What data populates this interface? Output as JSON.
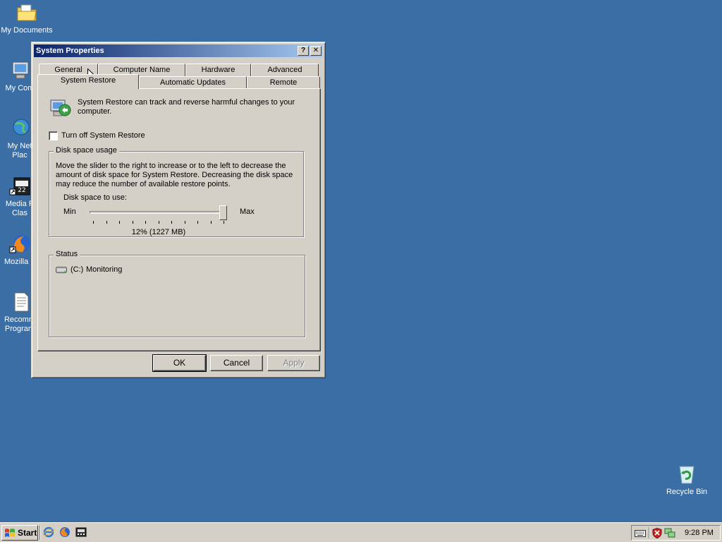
{
  "desktop": {
    "icons": [
      {
        "label": "My Documents",
        "icon": "folder-documents-icon"
      },
      {
        "label": "My Com",
        "icon": "computer-icon"
      },
      {
        "label": "My Net",
        "label2": "Plac",
        "icon": "network-places-icon"
      },
      {
        "label": "Media P",
        "label2": "Clas",
        "icon": "media-player-shortcut-icon"
      },
      {
        "label": "Mozilla F",
        "icon": "firefox-shortcut-icon"
      },
      {
        "label": "Recomm",
        "label2": "Program",
        "icon": "document-icon"
      },
      {
        "label": "Recycle Bin",
        "icon": "recycle-bin-icon"
      }
    ]
  },
  "dialog": {
    "title": "System Properties",
    "help_glyph": "?",
    "close_glyph": "✕",
    "tabs_row1": [
      "General",
      "Computer Name",
      "Hardware",
      "Advanced"
    ],
    "tabs_row2": [
      "System Restore",
      "Automatic Updates",
      "Remote"
    ],
    "active_tab": "System Restore",
    "intro": "System Restore can track and reverse harmful changes to your computer.",
    "turn_off_label": "Turn off System Restore",
    "turn_off_checked": false,
    "disk_group": {
      "legend": "Disk space usage",
      "description": "Move the slider to the right to increase or to the left to decrease the amount of disk space for System Restore. Decreasing the disk space may reduce the number of available restore points.",
      "slider_label": "Disk space to use:",
      "min_label": "Min",
      "max_label": "Max",
      "slider_fraction": 1.0,
      "value_text": "12% (1227 MB)"
    },
    "status_group": {
      "legend": "Status",
      "drives": [
        {
          "drive": "(C:)",
          "status": "Monitoring",
          "icon": "hard-drive-icon"
        }
      ]
    },
    "buttons": {
      "ok": "OK",
      "cancel": "Cancel",
      "apply": "Apply"
    }
  },
  "taskbar": {
    "start_label": "Start",
    "quick_launch": [
      "internet-explorer-icon",
      "firefox-icon",
      "media-player-classic-icon"
    ],
    "tray_icons": [
      "keyboard-icon",
      "security-shield-icon",
      "network-icon"
    ],
    "clock": "9:28 PM"
  },
  "colors": {
    "desktop": "#3a6ea5",
    "titlebar_start": "#0a246a",
    "titlebar_end": "#a6caf0",
    "face": "#d4d0c8"
  }
}
